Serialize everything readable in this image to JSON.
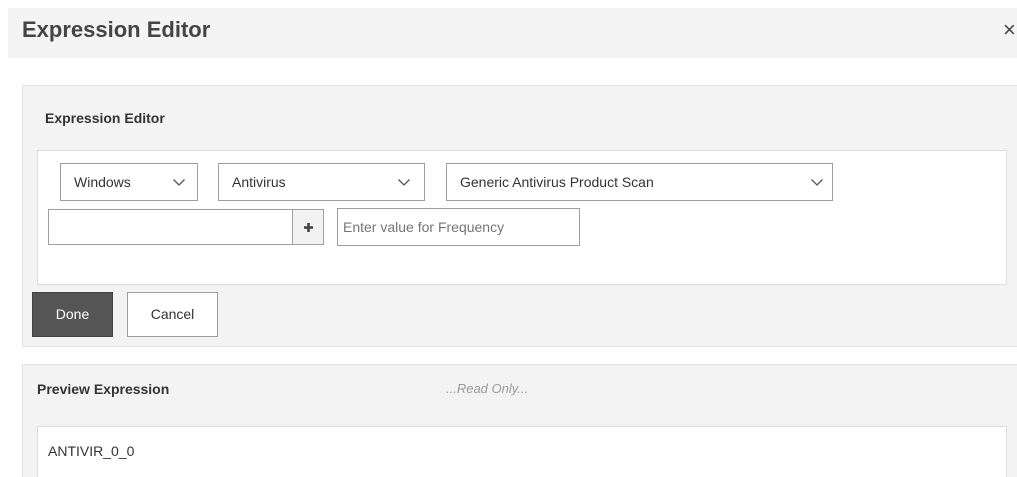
{
  "dialog": {
    "title": "Expression Editor",
    "close_symbol": "×"
  },
  "editor": {
    "label": "Expression Editor",
    "selects": [
      {
        "value": "Windows"
      },
      {
        "value": "Antivirus"
      },
      {
        "value": "Generic Antivirus Product Scan"
      }
    ],
    "value_input": {
      "value": "",
      "placeholder": ""
    },
    "frequency_input": {
      "value": "",
      "placeholder": "Enter value for Frequency"
    },
    "plus_icon": "plus-icon",
    "done_label": "Done",
    "cancel_label": "Cancel"
  },
  "preview": {
    "label": "Preview Expression",
    "readonly_note": "...Read Only...",
    "expression": "ANTIVIR_0_0"
  },
  "colors": {
    "primary_button": "#555555",
    "panel_bg": "#f3f3f3",
    "header_bg": "#f4f4f4",
    "border": "#9e9e9e"
  }
}
